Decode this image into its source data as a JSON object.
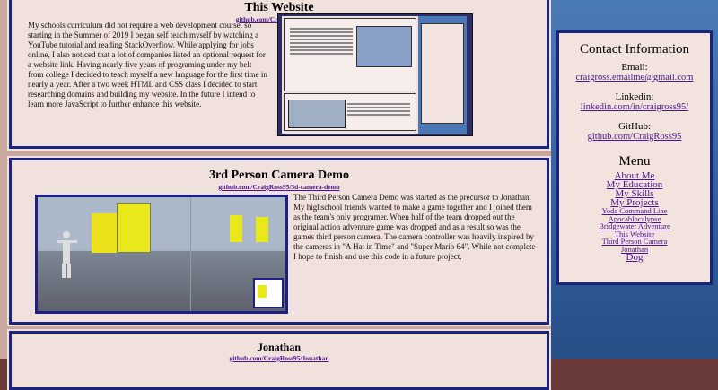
{
  "section_website": {
    "title": "This Website",
    "link": "github.com/CraigRoss95/yoda",
    "text": "My schools curriculum did not require a web development course, so starting in the Summer of 2019 I began self teach myself by watching a YouTube tutorial and reading StackOverflow. While applying for jobs online, I also noticed that a lot of companies listed an optional request for a website link. Having nearly five years of programing under my belt from college I decided to teach myself a new language for the first time in nearly a year. After a two week HTML and CSS class I decided to start researching domains and building my website. In the future I intend to learn more JavaScript to further enhance this website."
  },
  "section_camera": {
    "title": "3rd Person Camera Demo",
    "link": "github.com/CraigRoss95/3d-camera-demo",
    "text": "The Third Person Camera Demo was started as the precursor to Jonathan. My highschool friends wanted to make a game together and I joined them as the team's only programer. When half of the team dropped out the original action adventure game was dropped and as a result so was the games third person camera. The camera controller was heavily inspired by the cameras in \"A Hat in Time\" and \"Super Mario 64\". While not complete I hope to finish and use this code in a future project."
  },
  "section_jonathan": {
    "title": "Jonathan",
    "link": "github.com/CraigRoss95/Jonathan"
  },
  "sidebar": {
    "contact_title": "Contact Information",
    "email_label": "Email:",
    "email_value": "craigross.emailme@gmail.com",
    "linkedin_label": "Linkedin:",
    "linkedin_value": "linkedin.com/in/craigross95/",
    "github_label": "GitHub:",
    "github_value": "github.com/CraigRoss95",
    "menu_title": "Menu",
    "menu_main": [
      "About Me",
      "My Education",
      "My Skills",
      "My Projects"
    ],
    "menu_projects": [
      "Yoda Command Line",
      "Apocablocalypse",
      "Bridgewater Adventure",
      "This Website",
      "Third Person Camera",
      "Jonathan"
    ],
    "menu_last": "Dog"
  },
  "colors": {
    "border": "#1a237e",
    "link": "#4a148c",
    "panel": "#f1e1dd",
    "sidebar": "#3f6ca9"
  }
}
